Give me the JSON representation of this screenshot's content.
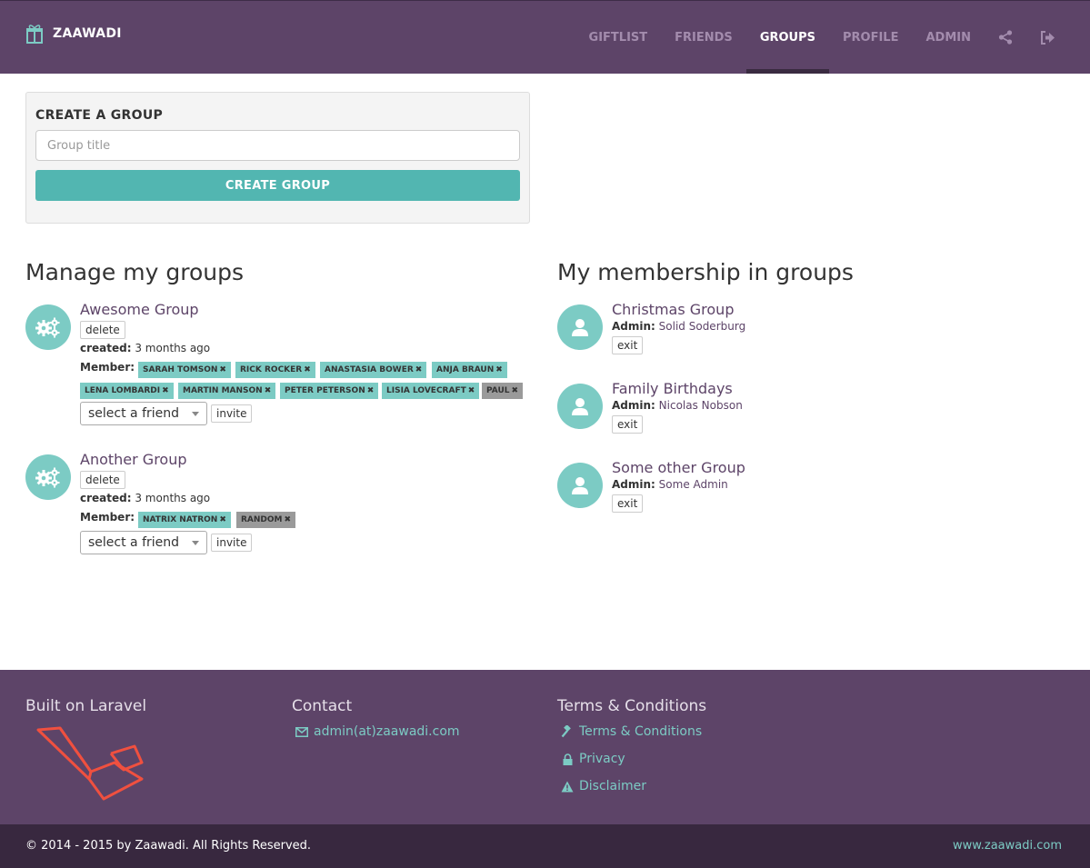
{
  "nav": {
    "brand": "ZAAWADI",
    "items": [
      {
        "label": "GIFTLIST"
      },
      {
        "label": "FRIENDS"
      },
      {
        "label": "GROUPS"
      },
      {
        "label": "PROFILE"
      },
      {
        "label": "ADMIN"
      }
    ],
    "icons": [
      "share-icon",
      "sign-out-icon"
    ]
  },
  "create_panel": {
    "heading": "CREATE A GROUP",
    "title_placeholder": "Group title",
    "button_label": "CREATE GROUP"
  },
  "manage": {
    "heading": "Manage my groups",
    "groups": [
      {
        "title": "Awesome Group",
        "delete_label": "delete",
        "created_label": "created:",
        "created_value": "3 months ago",
        "member_label": "Member:",
        "members": [
          "SARAH TOMSON",
          "RICK ROCKER",
          "ANASTASIA BOWER",
          "ANJA BRAUN",
          "LENA LOMBARDI",
          "MARTIN MANSON",
          "PETER PETERSON",
          "LISIA LOVECRAFT",
          "PAUL"
        ],
        "select_label": "select a friend",
        "invite_label": "invite"
      },
      {
        "title": "Another Group",
        "delete_label": "delete",
        "created_label": "created:",
        "created_value": "3 months ago",
        "member_label": "Member:",
        "members": [
          "NATRIX NATRON",
          "RANDOM"
        ],
        "select_label": "select a friend",
        "invite_label": "invite"
      }
    ]
  },
  "membership": {
    "heading": "My membership in groups",
    "groups": [
      {
        "title": "Christmas Group",
        "admin_label": "Admin:",
        "admin": "Solid Soderburg",
        "exit_label": "exit"
      },
      {
        "title": "Family Birthdays",
        "admin_label": "Admin:",
        "admin": "Nicolas Nobson",
        "exit_label": "exit"
      },
      {
        "title": "Some other Group",
        "admin_label": "Admin:",
        "admin": "Some Admin",
        "exit_label": "exit"
      }
    ]
  },
  "footer": {
    "col1_heading": "Built on Laravel",
    "col2_heading": "Contact",
    "contact_email": "admin(at)zaawadi.com",
    "col3_heading": "Terms & Conditions",
    "links": [
      "Terms & Conditions",
      "Privacy",
      "Disclaimer"
    ],
    "copyright": "© 2014 - 2015 by Zaawadi. All Rights Reserved.",
    "site": "www.zaawadi.com"
  },
  "colors": {
    "brand": "#5d4468",
    "accent": "#52b6b1",
    "tag": "#7ccbc4",
    "laravel": "#f0503f"
  }
}
